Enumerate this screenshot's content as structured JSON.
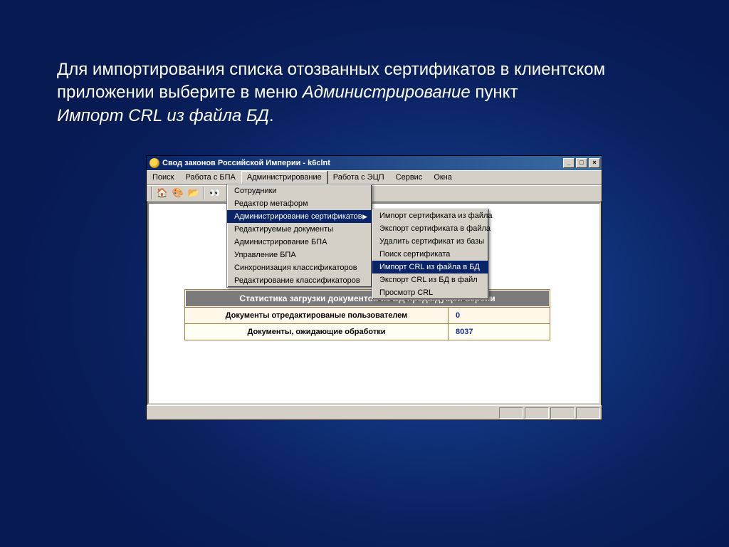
{
  "slide": {
    "line1a": "Для импортирования списка отозванных сертификатов в клиентском приложении выберите в меню ",
    "line1b": "Администрирование",
    "line1c": " пункт ",
    "line2a": "Импорт CRL из файла БД",
    "line2b": "."
  },
  "titlebar": {
    "title": "Свод законов Российской Империи - k6clnt",
    "min": "_",
    "max": "□",
    "close": "×"
  },
  "menubar": {
    "items": [
      "Поиск",
      "Работа с БПА",
      "Администрирование",
      "Работа с ЭЦП",
      "Сервис",
      "Окна"
    ],
    "open_index": 2
  },
  "dropdown_main": {
    "items": [
      {
        "label": "Сотрудники"
      },
      {
        "label": "Редактор метаформ"
      },
      {
        "label": "Администрирование сертификатов",
        "submenu": true,
        "highlight": true
      },
      {
        "label": "Редактируемые документы"
      },
      {
        "label": "Администрирование БПА"
      },
      {
        "label": "Управление БПА"
      },
      {
        "label": "Синхронизация классификаторов"
      },
      {
        "label": "Редактирование классификаторов"
      }
    ]
  },
  "dropdown_sub": {
    "items": [
      {
        "label": "Импорт сертификата из файла"
      },
      {
        "label": "Экспорт сертификата в файла"
      },
      {
        "label": "Удалить сертификат из базы"
      },
      {
        "label": "Поиск сертификата"
      },
      {
        "label": "Импорт CRL из файла в БД",
        "highlight": true
      },
      {
        "label": "Экспорт CRL из БД в файл"
      },
      {
        "label": "Просмотр CRL"
      }
    ]
  },
  "stats": {
    "header": "Статистика загрузки документов из БД предыдущей версии",
    "rows": [
      {
        "label": "Документы отредактированые пользователем",
        "value": "0"
      },
      {
        "label": "Документы, ожидающие обработки",
        "value": "8037"
      }
    ]
  },
  "toolbar": {
    "icons": [
      "house-icon",
      "palette-icon",
      "folder-icon",
      "binoculars-icon"
    ]
  }
}
